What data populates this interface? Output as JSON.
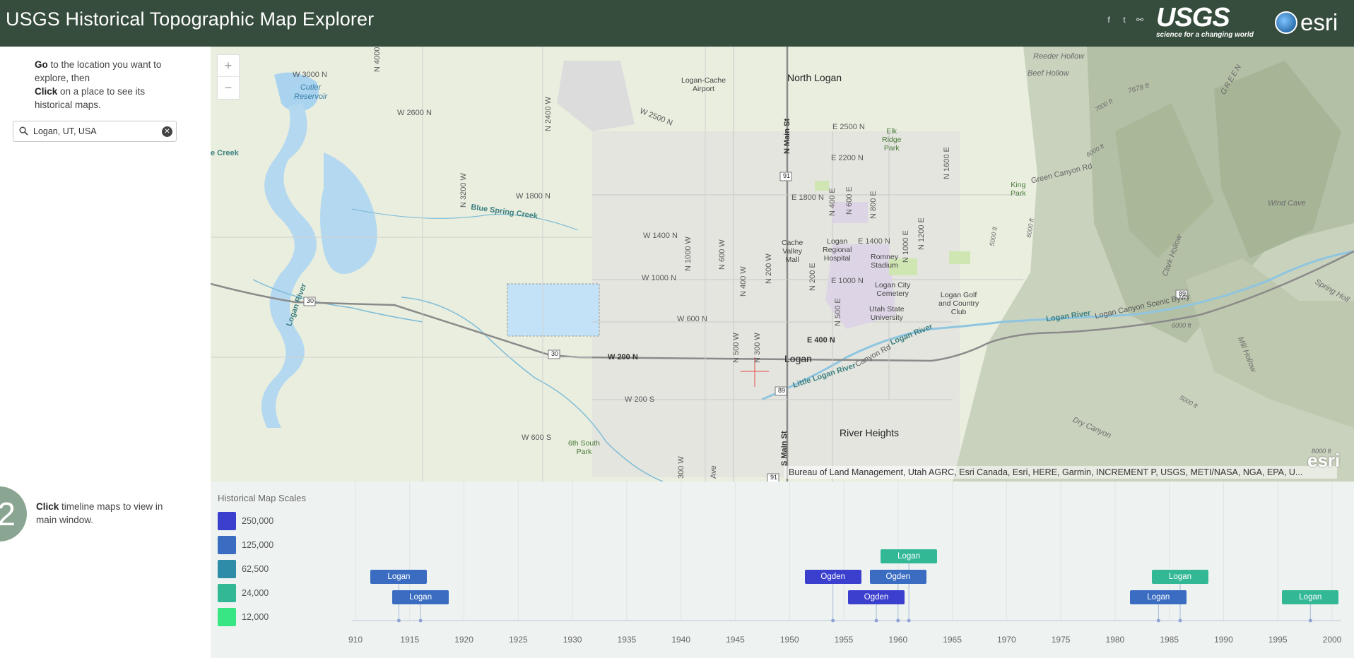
{
  "header": {
    "title": "USGS Historical Topographic Map Explorer",
    "share_icons": [
      "facebook-icon",
      "twitter-icon",
      "link-icon"
    ],
    "usgs_logo_text": "USGS",
    "usgs_tagline": "science for a changing world",
    "esri_logo_text": "esri",
    "background_color": "#364c3c"
  },
  "sidebar": {
    "step1_go": "Go",
    "step1_text_a": " to the location you want to explore, then",
    "step1_click": "Click",
    "step1_text_b": " on a place to see its historical maps.",
    "search": {
      "value": "Logan, UT, USA",
      "placeholder": ""
    },
    "step2_number": "2",
    "step2_click": "Click",
    "step2_text": " timeline maps to view in main window."
  },
  "map": {
    "zoom_in": "+",
    "zoom_out": "−",
    "attribution": "Bureau of Land Management, Utah AGRC, Esri Canada, Esri, HERE, Garmin, INCREMENT P, USGS, METI/NASA, NGA, EPA, U...",
    "powered_by": "esri",
    "labels": {
      "north_logan": "North Logan",
      "logan": "Logan",
      "river_heights": "River Heights",
      "cutler_reservoir": "Cutler\nReservoir",
      "airport": "Logan-Cache\nAirport",
      "blue_spring_creek": "Blue Spring Creek",
      "little_logan_river": "Little Logan River",
      "logan_river_e": "Logan River",
      "logan_river_w": "Logan River",
      "logan_river_mtn": "Logan River",
      "scenic_byway": "Logan Canyon Scenic Bywy",
      "green_canyon_rd": "Green Canyon Rd",
      "wind_cave": "Wind Cave",
      "reeder_hollow": "Reeder Hollow",
      "beef_hollow": "Beef Hollow",
      "dry_canyon": "Dry Canyon",
      "clark_hollow": "Clark Hollow",
      "mill_hollow": "Mill Hollow",
      "spring_hollow": "Spring Holl",
      "green": "GREEN",
      "elk_ridge_park": "Elk\nRidge\nPark",
      "king_park": "King\nPark",
      "cache_valley_mall": "Cache\nValley\nMall",
      "logan_regional_hospital": "Logan\nRegional\nHospital",
      "romney_stadium": "Romney\nStadium",
      "logan_city_cemetery": "Logan City\nCemetery",
      "utah_state_university": "Utah State\nUniversity",
      "logan_golf": "Logan Golf\nand Country\nClub",
      "sixth_south_park": "6th South\nPark",
      "e_creek": "e Creek",
      "w3000n": "W 3000 N",
      "n4000w": "N 4000 W",
      "w2600n": "W 2600 N",
      "n2400w": "N 2400 W",
      "w2500n": "W 2500 N",
      "w1800n": "W 1800 N",
      "n3200w": "N 3200 W",
      "w1400n": "W 1400 N",
      "n1000w": "N 1000 W",
      "w1000n": "W 1000 N",
      "n600w": "N 600 W",
      "w600n": "W 600 N",
      "n400w": "N 400 W",
      "n200w": "N 200 W",
      "w200n": "W 200 N",
      "w200s": "W 200 S",
      "w600s": "W 600 S",
      "n500w": "N 500 W",
      "n300w": "N 300 W",
      "s_main_st": "S Main St",
      "n_main_st": "N Main St",
      "e2500n": "E 2500 N",
      "e2200n": "E 2200 N",
      "e1800n": "E 1800 N",
      "e1400n": "E 1400 N",
      "e1000n": "E 1000 N",
      "e400n": "E 400 N",
      "n400e": "N 400 E",
      "n600e": "N 600 E",
      "n800e": "N 800 E",
      "n1200e": "N 1200 E",
      "n1600e": "N 1600 E",
      "n200e": "N 200 E",
      "n1000e": "N 1000 E",
      "n500e": "N 500 E",
      "canyon_rd": "Canyon Rd",
      "ave": "Ave",
      "w300_partial": "300 W",
      "elev_7678": "7678 ft",
      "elev_7000": "7000 ft",
      "elev_6000a": "6000 ft",
      "elev_5000": "5000 ft",
      "elev_6000b": "6000 ft",
      "elev_8000": "8000 ft",
      "elev_6000c": "6000 ft",
      "elev_5000b": "5000 ft",
      "rt30_a": "30",
      "rt30_b": "30",
      "rt91": "91",
      "rt89_a": "89",
      "rt89_b": "89",
      "rt91_b": "91"
    }
  },
  "timeline": {
    "legend_title": "Historical Map Scales",
    "legend": [
      {
        "label": "250,000",
        "color": "#3b3fce"
      },
      {
        "label": "125,000",
        "color": "#3a6dc2"
      },
      {
        "label": "62,500",
        "color": "#2e8ca8"
      },
      {
        "label": "24,000",
        "color": "#33b896"
      },
      {
        "label": "12,000",
        "color": "#39e684"
      }
    ],
    "axis_ticks": [
      "910",
      "1915",
      "1920",
      "1925",
      "1930",
      "1935",
      "1940",
      "1945",
      "1950",
      "1955",
      "1960",
      "1965",
      "1970",
      "1975",
      "1980",
      "1985",
      "1990",
      "1995",
      "2000"
    ],
    "maps": [
      {
        "name": "Logan",
        "year": 1914,
        "color": "#3a6dc2",
        "level": 2
      },
      {
        "name": "Logan",
        "year": 1916,
        "color": "#3a6dc2",
        "level": 1
      },
      {
        "name": "Ogden",
        "year": 1954,
        "color": "#3b3fce",
        "level": 2
      },
      {
        "name": "Ogden",
        "year": 1958,
        "color": "#3b3fce",
        "level": 1
      },
      {
        "name": "Ogden",
        "year": 1960,
        "color": "#3a6dc2",
        "level": 2
      },
      {
        "name": "Logan",
        "year": 1961,
        "color": "#33b896",
        "level": 3
      },
      {
        "name": "Logan",
        "year": 1984,
        "color": "#3a6dc2",
        "level": 1
      },
      {
        "name": "Logan",
        "year": 1986,
        "color": "#33b896",
        "level": 2
      },
      {
        "name": "Logan",
        "year": 1998,
        "color": "#33b896",
        "level": 1
      }
    ]
  }
}
